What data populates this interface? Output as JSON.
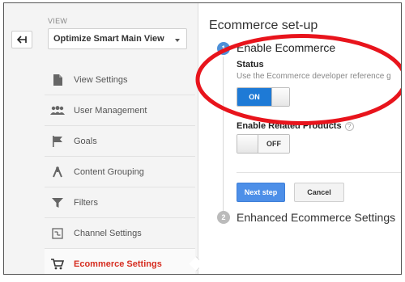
{
  "sidebar": {
    "view_label": "VIEW",
    "view_select": "Optimize Smart Main View",
    "items": [
      {
        "label": "View Settings",
        "icon": "document-icon"
      },
      {
        "label": "User Management",
        "icon": "users-icon"
      },
      {
        "label": "Goals",
        "icon": "flag-icon"
      },
      {
        "label": "Content Grouping",
        "icon": "grouping-icon"
      },
      {
        "label": "Filters",
        "icon": "filter-icon"
      },
      {
        "label": "Channel Settings",
        "icon": "channel-icon"
      },
      {
        "label": "Ecommerce Settings",
        "icon": "cart-icon"
      }
    ]
  },
  "main": {
    "title": "Ecommerce set-up",
    "step1": {
      "number": "1",
      "title": "Enable Ecommerce"
    },
    "status_label": "Status",
    "status_desc": "Use the Ecommerce developer reference g",
    "status_toggle": "ON",
    "related_label": "Enable Related Products",
    "help_glyph": "?",
    "related_toggle": "OFF",
    "next_button": "Next step",
    "cancel_button": "Cancel",
    "step2": {
      "number": "2",
      "title": "Enhanced Ecommerce Settings"
    }
  },
  "colors": {
    "accent_blue": "#1e7ad6",
    "active_red": "#d62d20",
    "highlight_red": "#e8141c"
  }
}
